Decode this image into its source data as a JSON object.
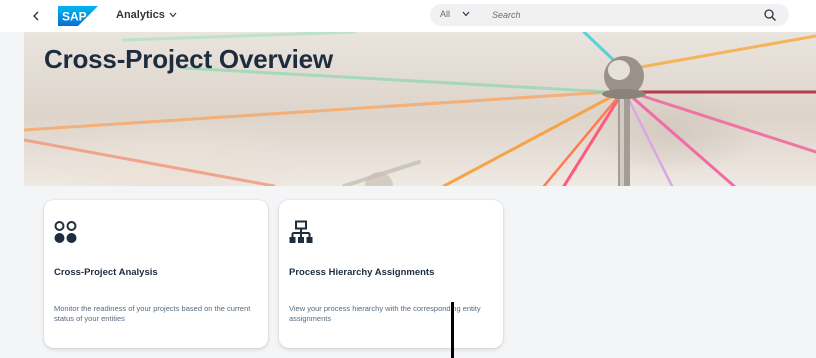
{
  "shell": {
    "back_icon": "chevron-left-icon",
    "logo_text": "SAP",
    "logo_color": "#0a6ed1",
    "app_title": "Analytics",
    "app_title_icon": "chevron-down-icon",
    "search": {
      "scope": "All",
      "scope_icon": "chevron-down-icon",
      "placeholder": "Search",
      "icon": "search-icon"
    }
  },
  "banner": {
    "title": "Cross-Project Overview"
  },
  "cards": [
    {
      "icon": "circles-grid-icon",
      "title": "Cross-Project Analysis",
      "description": "Monitor the readiness of your projects based on the current status of your entities"
    },
    {
      "icon": "hierarchy-icon",
      "title": "Process Hierarchy Assignments",
      "description": "View your process hierarchy with the corresponding entity assignments"
    }
  ],
  "colors": {
    "accent": "#0a6ed1",
    "title_text": "#1d2d3e",
    "background": "#f4f5f7"
  }
}
